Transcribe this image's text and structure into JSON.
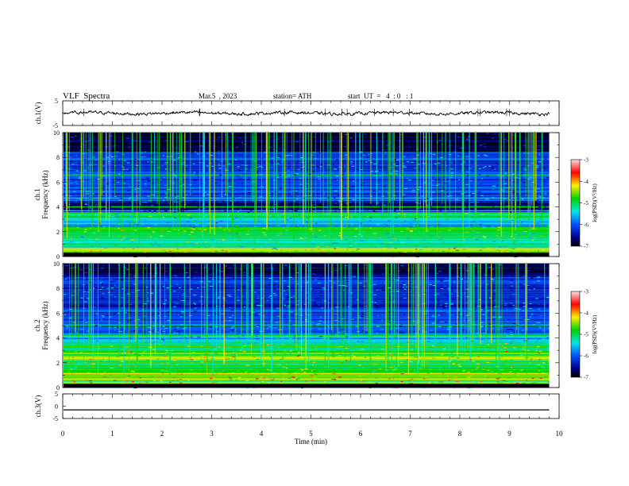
{
  "header": {
    "title": "VLF  Spectra",
    "date": "Mar.5  , 2023",
    "station": "station= ATH",
    "start": "start  UT  =   4  : 0   : 1"
  },
  "chart_data": [
    {
      "type": "line",
      "panel": "ch1-waveform",
      "ylabel": "ch.1(V)",
      "ylim": [
        -5,
        5
      ],
      "y_ticks": [
        "5",
        "-5"
      ],
      "xlim": [
        0,
        10
      ],
      "series": [
        {
          "values_summary": {
            "mean": 0,
            "min": -1.2,
            "max": 1.2
          },
          "x_range": [
            0,
            9.8
          ]
        }
      ]
    },
    {
      "type": "heatmap",
      "panel": "ch1-spectrogram",
      "ylabel": "ch.1\nFrequency (kHz)",
      "ylim": [
        0,
        10
      ],
      "y_ticks": [
        "0",
        "2",
        "4",
        "6",
        "8",
        "10"
      ],
      "xlim": [
        0,
        10
      ],
      "x_data_range": [
        0,
        9.8
      ],
      "colorbar": {
        "label": "log(PSD)(V²/Hz)",
        "ticks": [
          "-3",
          "-4",
          "-5",
          "-6",
          "-7"
        ],
        "range": [
          -7,
          -3
        ]
      },
      "bands_khz": [
        {
          "from": 0,
          "to": 0.3,
          "level": -7
        },
        {
          "from": 0.3,
          "to": 0.7,
          "level": -4.5
        },
        {
          "from": 0.7,
          "to": 2.0,
          "level": -5.2
        },
        {
          "from": 2.0,
          "to": 2.4,
          "level": -4.8
        },
        {
          "from": 2.4,
          "to": 3.2,
          "level": -5.6
        },
        {
          "from": 3.2,
          "to": 3.6,
          "level": -5.2
        },
        {
          "from": 3.6,
          "to": 4.5,
          "level": -6.6
        },
        {
          "from": 4.5,
          "to": 5.0,
          "level": -6.0
        },
        {
          "from": 5.0,
          "to": 8.5,
          "level": -6.1
        },
        {
          "from": 8.5,
          "to": 10.0,
          "level": -6.9
        }
      ],
      "lines_khz": [
        0.9,
        1.6,
        2.1,
        2.3,
        3.1,
        3.5,
        3.7,
        4.0,
        4.7,
        6.6
      ]
    },
    {
      "type": "heatmap",
      "panel": "ch2-spectrogram",
      "ylabel": "ch.2\nFrequency (kHz)",
      "ylim": [
        0,
        10
      ],
      "y_ticks": [
        "0",
        "2",
        "4",
        "6",
        "8",
        "10"
      ],
      "xlim": [
        0,
        10
      ],
      "x_data_range": [
        0,
        9.8
      ],
      "colorbar": {
        "label": "log(PSD)(V²/Hz)",
        "ticks": [
          "-3",
          "-4",
          "-5",
          "-6",
          "-7"
        ],
        "range": [
          -7,
          -3
        ]
      },
      "bands_khz": [
        {
          "from": 0,
          "to": 0.3,
          "level": -7
        },
        {
          "from": 0.3,
          "to": 1.2,
          "level": -4.3
        },
        {
          "from": 1.2,
          "to": 2.2,
          "level": -5.0
        },
        {
          "from": 2.2,
          "to": 3.0,
          "level": -4.6
        },
        {
          "from": 3.0,
          "to": 3.6,
          "level": -5.0
        },
        {
          "from": 3.6,
          "to": 4.4,
          "level": -5.6
        },
        {
          "from": 4.4,
          "to": 6.0,
          "level": -6.0
        },
        {
          "from": 6.0,
          "to": 9.0,
          "level": -6.2
        },
        {
          "from": 9.0,
          "to": 10.0,
          "level": -6.8
        }
      ],
      "lines_khz": [
        0.5,
        0.8,
        1.8,
        2.0,
        3.0,
        3.3,
        4.2,
        5.0
      ]
    },
    {
      "type": "line",
      "panel": "ch3-waveform",
      "ylabel": "ch.3(V)",
      "ylim": [
        -5,
        5
      ],
      "y_ticks": [
        "5",
        "0",
        "-5"
      ],
      "xlim": [
        0,
        10
      ],
      "series": [
        {
          "values_summary": {
            "mean": -1.5,
            "min": -1.7,
            "max": -1.3
          },
          "x_range": [
            0,
            9.8
          ]
        }
      ]
    }
  ],
  "x_axis": {
    "label": "Time  (min)",
    "ticks": [
      "0",
      "1",
      "2",
      "3",
      "4",
      "5",
      "6",
      "7",
      "8",
      "9",
      "10"
    ]
  },
  "colors": {
    "low": "#000000",
    "blue_dark": "#00008c",
    "blue": "#0050ff",
    "cyan": "#00e6e6",
    "green": "#00d200",
    "yellow": "#fff000",
    "red": "#ff0000",
    "pink": "#ffc8c8"
  }
}
